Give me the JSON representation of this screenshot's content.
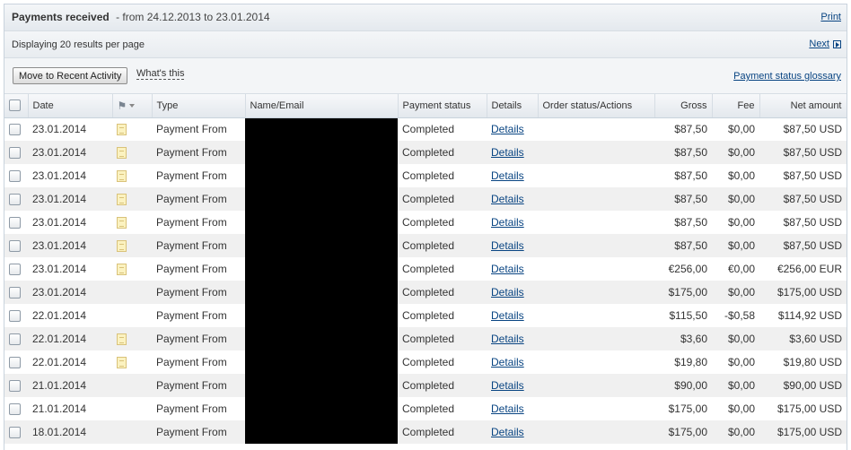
{
  "header": {
    "title": "Payments received",
    "date_range": "- from 24.12.2013 to 23.01.2014",
    "print_label": "Print"
  },
  "pager": {
    "displaying": "Displaying 20 results per page",
    "next_label": "Next"
  },
  "toolbar": {
    "move_button": "Move to Recent Activity",
    "whats_this": "What's this",
    "glossary_link": "Payment status glossary"
  },
  "columns": {
    "date": "Date",
    "type": "Type",
    "name_email": "Name/Email",
    "payment_status": "Payment status",
    "details": "Details",
    "order_status": "Order status/Actions",
    "gross": "Gross",
    "fee": "Fee",
    "net": "Net amount"
  },
  "icons": {
    "note": "note-icon",
    "flag": "flag-icon"
  },
  "rows": [
    {
      "date": "23.01.2014",
      "note": true,
      "type": "Payment From",
      "status": "Completed",
      "details": "Details",
      "gross": "$87,50",
      "fee": "$0,00",
      "net": "$87,50 USD"
    },
    {
      "date": "23.01.2014",
      "note": true,
      "type": "Payment From",
      "status": "Completed",
      "details": "Details",
      "gross": "$87,50",
      "fee": "$0,00",
      "net": "$87,50 USD"
    },
    {
      "date": "23.01.2014",
      "note": true,
      "type": "Payment From",
      "status": "Completed",
      "details": "Details",
      "gross": "$87,50",
      "fee": "$0,00",
      "net": "$87,50 USD"
    },
    {
      "date": "23.01.2014",
      "note": true,
      "type": "Payment From",
      "status": "Completed",
      "details": "Details",
      "gross": "$87,50",
      "fee": "$0,00",
      "net": "$87,50 USD"
    },
    {
      "date": "23.01.2014",
      "note": true,
      "type": "Payment From",
      "status": "Completed",
      "details": "Details",
      "gross": "$87,50",
      "fee": "$0,00",
      "net": "$87,50 USD"
    },
    {
      "date": "23.01.2014",
      "note": true,
      "type": "Payment From",
      "status": "Completed",
      "details": "Details",
      "gross": "$87,50",
      "fee": "$0,00",
      "net": "$87,50 USD"
    },
    {
      "date": "23.01.2014",
      "note": true,
      "type": "Payment From",
      "status": "Completed",
      "details": "Details",
      "gross": "€256,00",
      "fee": "€0,00",
      "net": "€256,00 EUR"
    },
    {
      "date": "23.01.2014",
      "note": false,
      "type": "Payment From",
      "status": "Completed",
      "details": "Details",
      "gross": "$175,00",
      "fee": "$0,00",
      "net": "$175,00 USD"
    },
    {
      "date": "22.01.2014",
      "note": false,
      "type": "Payment From",
      "status": "Completed",
      "details": "Details",
      "gross": "$115,50",
      "fee": "-$0,58",
      "net": "$114,92 USD"
    },
    {
      "date": "22.01.2014",
      "note": true,
      "type": "Payment From",
      "status": "Completed",
      "details": "Details",
      "gross": "$3,60",
      "fee": "$0,00",
      "net": "$3,60 USD"
    },
    {
      "date": "22.01.2014",
      "note": true,
      "type": "Payment From",
      "status": "Completed",
      "details": "Details",
      "gross": "$19,80",
      "fee": "$0,00",
      "net": "$19,80 USD"
    },
    {
      "date": "21.01.2014",
      "note": false,
      "type": "Payment From",
      "status": "Completed",
      "details": "Details",
      "gross": "$90,00",
      "fee": "$0,00",
      "net": "$90,00 USD"
    },
    {
      "date": "21.01.2014",
      "note": false,
      "type": "Payment From",
      "status": "Completed",
      "details": "Details",
      "gross": "$175,00",
      "fee": "$0,00",
      "net": "$175,00 USD"
    },
    {
      "date": "18.01.2014",
      "note": false,
      "type": "Payment From",
      "status": "Completed",
      "details": "Details",
      "gross": "$175,00",
      "fee": "$0,00",
      "net": "$175,00 USD"
    }
  ]
}
